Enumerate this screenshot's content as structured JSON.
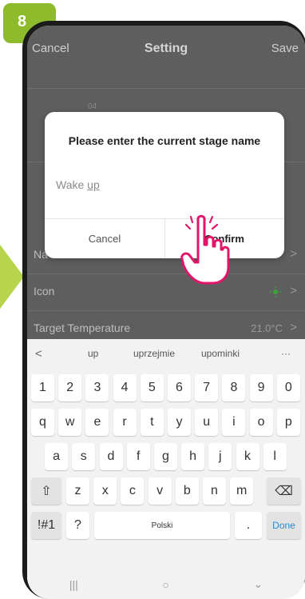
{
  "step_number": "8",
  "app": {
    "header": {
      "cancel_label": "Cancel",
      "title": "Setting",
      "save_label": "Save"
    },
    "picker_value": "04",
    "rows": [
      {
        "label": "Na",
        "value": ""
      },
      {
        "label": "Icon",
        "value": ""
      },
      {
        "label": "Target Temperature",
        "value": "21.0°C"
      }
    ],
    "icon_color": "#3aa23a"
  },
  "dialog": {
    "title": "Please enter the current stage name",
    "input_value": "Wake ",
    "input_value_underlined": "up",
    "cancel_label": "Cancel",
    "confirm_label": "Confirm"
  },
  "keyboard": {
    "suggestions": [
      "up",
      "uprzejmie",
      "upominki"
    ],
    "suggestion_back_icon": "back-icon",
    "suggestion_more": "···",
    "number_row": [
      "1",
      "2",
      "3",
      "4",
      "5",
      "6",
      "7",
      "8",
      "9",
      "0"
    ],
    "row1": [
      "q",
      "w",
      "e",
      "r",
      "t",
      "y",
      "u",
      "i",
      "o",
      "p"
    ],
    "row2": [
      "a",
      "s",
      "d",
      "f",
      "g",
      "h",
      "j",
      "k",
      "l"
    ],
    "row3": [
      "z",
      "x",
      "c",
      "v",
      "b",
      "n",
      "m"
    ],
    "symbols_label": "!#1",
    "question_label": "?",
    "space_label": "Polski",
    "period_label": ".",
    "done_label": "Done"
  },
  "navbar": {
    "recents": "|||",
    "home": "○",
    "back": "⌄"
  },
  "accent_color": "#8dbb2c",
  "highlight_color": "#e2156b"
}
